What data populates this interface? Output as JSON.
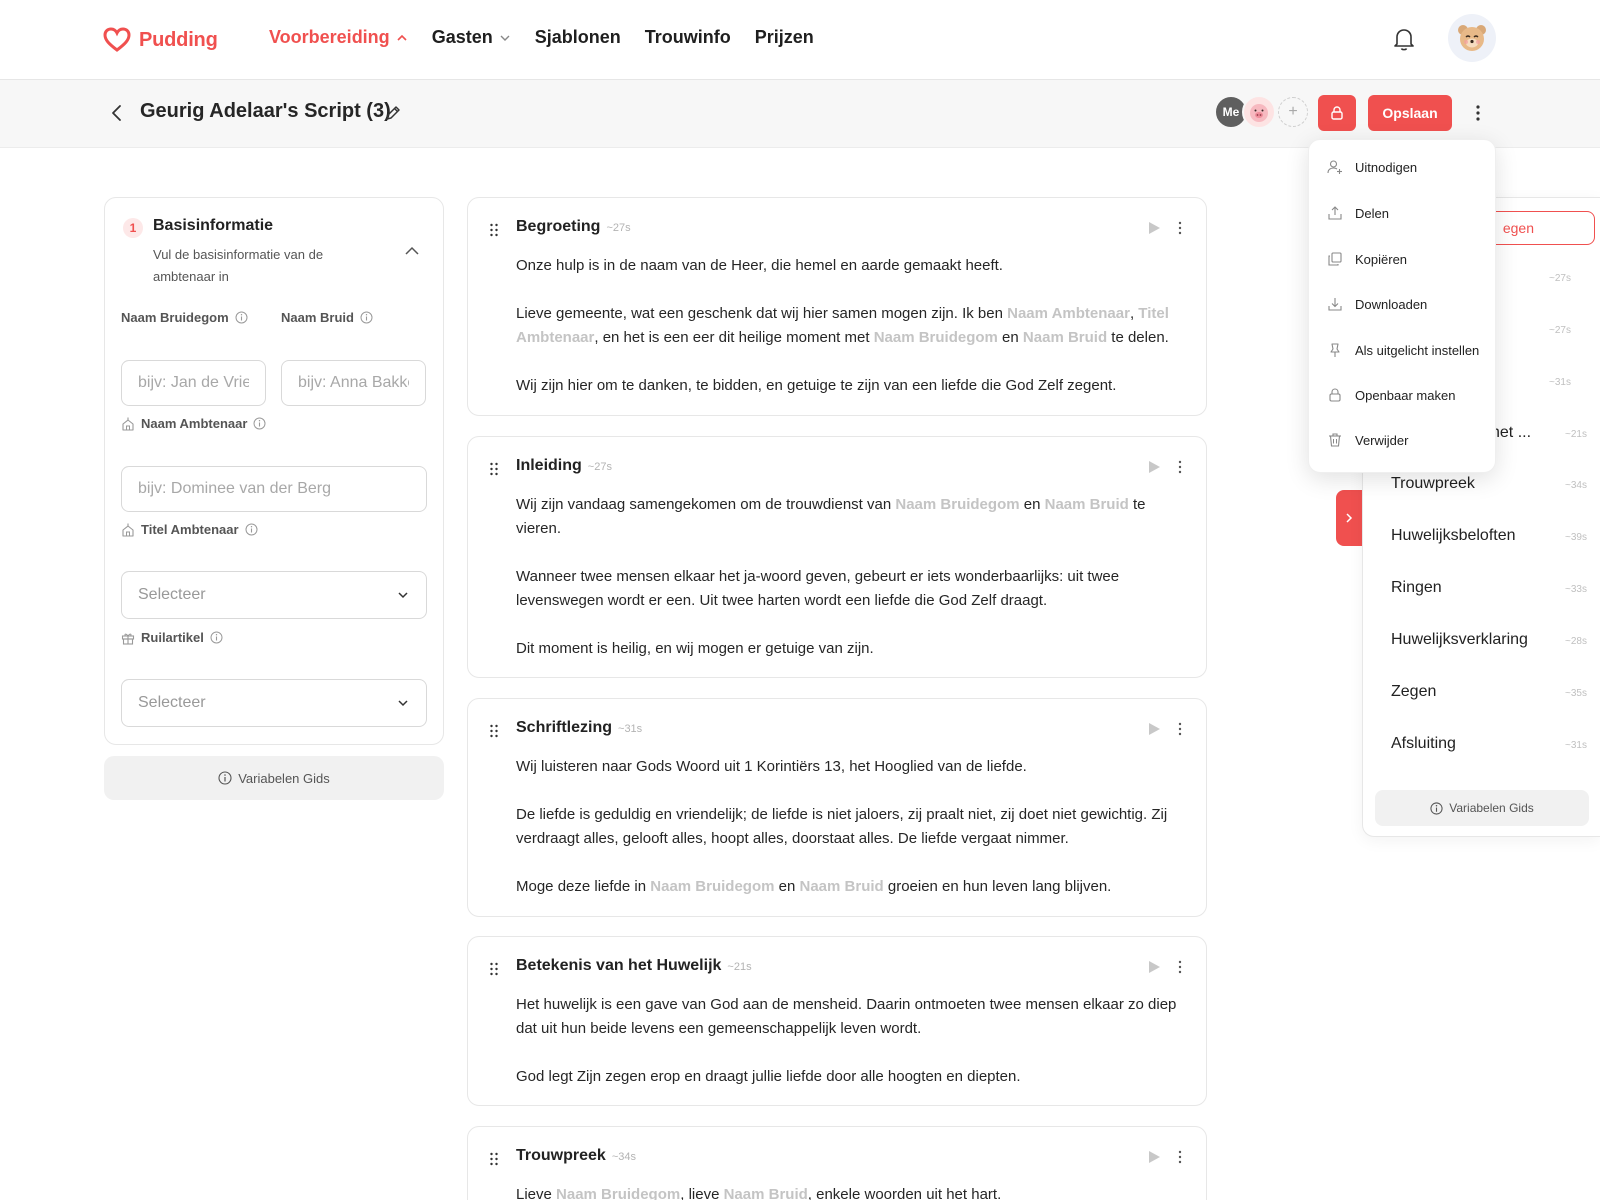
{
  "brand": {
    "name": "Pudding",
    "accent": "#f0504f"
  },
  "nav": {
    "items": [
      {
        "label": "Voorbereiding",
        "active": true,
        "icon": "chevron-up-icon"
      },
      {
        "label": "Gasten",
        "active": false,
        "icon": "chevron-down-icon"
      },
      {
        "label": "Sjablonen",
        "active": false
      },
      {
        "label": "Trouwinfo",
        "active": false
      },
      {
        "label": "Prijzen",
        "active": false
      }
    ]
  },
  "header": {
    "title": "Geurig Adelaar's Script (3)",
    "collaborator_me": "Me",
    "add_collaborator": "+",
    "save_label": "Opslaan"
  },
  "menu": {
    "items": [
      {
        "label": "Uitnodigen",
        "icon": "user-plus-icon"
      },
      {
        "label": "Delen",
        "icon": "share-icon"
      },
      {
        "label": "Kopiëren",
        "icon": "copy-icon"
      },
      {
        "label": "Downloaden",
        "icon": "download-icon"
      },
      {
        "label": "Als uitgelicht instellen",
        "icon": "pin-icon"
      },
      {
        "label": "Openbaar maken",
        "icon": "lock-icon"
      },
      {
        "label": "Verwijder",
        "icon": "trash-icon"
      }
    ]
  },
  "form": {
    "step_number": "1",
    "step_title": "Basisinformatie",
    "step_description": "Vul de basisinformatie van de ambtenaar in",
    "groom_label": "Naam Bruidegom",
    "groom_placeholder": "bijv: Jan de Vries",
    "bride_label": "Naam Bruid",
    "bride_placeholder": "bijv: Anna Bakker",
    "officiant_label": "Naam Ambtenaar",
    "officiant_placeholder": "bijv: Dominee van der Berg",
    "title_label": "Titel Ambtenaar",
    "title_select": "Selecteer",
    "exchange_label": "Ruilartikel",
    "exchange_select": "Selecteer",
    "guide_label": "Variabelen Gids"
  },
  "sections": [
    {
      "title": "Begroeting",
      "duration": "~27s",
      "p1": "Onze hulp is in de naam van de Heer, die hemel en aarde gemaakt heeft.",
      "p2a": "Lieve gemeente, wat een geschenk dat wij hier samen mogen zijn. Ik ben ",
      "var1": "Naam Ambtenaar",
      "p2b": ", ",
      "var2": "Titel Ambtenaar",
      "p2c": ", en het is een eer dit heilige moment met ",
      "var3": "Naam Bruidegom",
      "p2d": " en ",
      "var4": "Naam Bruid",
      "p2e": " te delen.",
      "p3": "Wij zijn hier om te danken, te bidden, en getuige te zijn van een liefde die God Zelf zegent."
    },
    {
      "title": "Inleiding",
      "duration": "~27s",
      "p1a": "Wij zijn vandaag samengekomen om de trouwdienst van ",
      "var1": "Naam Bruidegom",
      "p1b": " en ",
      "var2": "Naam Bruid",
      "p1c": " te vieren.",
      "p2": "Wanneer twee mensen elkaar het ja-woord geven, gebeurt er iets wonderbaarlijks: uit twee levenswegen wordt er een. Uit twee harten wordt een liefde die God Zelf draagt.",
      "p3": "Dit moment is heilig, en wij mogen er getuige van zijn."
    },
    {
      "title": "Schriftlezing",
      "duration": "~31s",
      "p1": "Wij luisteren naar Gods Woord uit 1 Korintiërs 13, het Hooglied van de liefde.",
      "p2": "De liefde is geduldig en vriendelijk; de liefde is niet jaloers, zij praalt niet, zij doet niet gewichtig. Zij verdraagt alles, gelooft alles, hoopt alles, doorstaat alles. De liefde vergaat nimmer.",
      "p3a": "Moge deze liefde in ",
      "var1": "Naam Bruidegom",
      "p3b": " en ",
      "var2": "Naam Bruid",
      "p3c": " groeien en hun leven lang blijven."
    },
    {
      "title": "Betekenis van het Huwelijk",
      "duration": "~21s",
      "p1": "Het huwelijk is een gave van God aan de mensheid. Daarin ontmoeten twee mensen elkaar zo diep dat uit hun beide levens een gemeenschappelijk leven wordt.",
      "p2": "God legt Zijn zegen erop en draagt jullie liefde door alle hoogten en diepten."
    },
    {
      "title": "Trouwpreek",
      "duration": "~34s",
      "p1a": "Lieve ",
      "var1": "Naam Bruidegom",
      "p1b": ", lieve ",
      "var2": "Naam Bruid",
      "p1c": ", enkele woorden uit het hart."
    }
  ],
  "outline": {
    "highlight_text": "egen",
    "hidden_durations": [
      "~27s",
      "~27s",
      "~31s"
    ],
    "partial_item": {
      "name": "het ...",
      "duration": "~21s"
    },
    "items": [
      {
        "name": "Trouwpreek",
        "duration": "~34s"
      },
      {
        "name": "Huwelijksbeloften",
        "duration": "~39s"
      },
      {
        "name": "Ringen",
        "duration": "~33s"
      },
      {
        "name": "Huwelijksverklaring",
        "duration": "~28s"
      },
      {
        "name": "Zegen",
        "duration": "~35s"
      },
      {
        "name": "Afsluiting",
        "duration": "~31s"
      }
    ],
    "guide_label": "Variabelen Gids"
  }
}
